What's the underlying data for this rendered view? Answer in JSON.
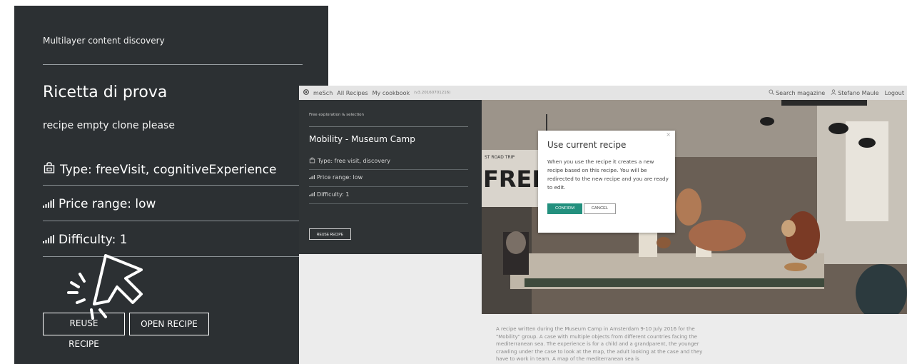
{
  "left_panel": {
    "section_label": "Multilayer content discovery",
    "title": "Ricetta di prova",
    "subtitle": "recipe empty clone please",
    "type_label": "Type: freeVisit, cognitiveExperience",
    "price_label": "Price range: low",
    "difficulty_label": "Difficulty: 1",
    "reuse_button": "REUSE RECIPE",
    "open_button": "OPEN RECIPE"
  },
  "app": {
    "topbar": {
      "brand": "meSch",
      "nav_all_recipes": "All Recipes",
      "nav_my_cookbook": "My cookbook",
      "version": "(v3.20160701216)",
      "search": "Search magazine",
      "user": "Stefano Maule",
      "logout": "Logout"
    },
    "sidebar": {
      "section_label": "Free exploration & selection",
      "title": "Mobility - Museum Camp",
      "type_label": "Type: free visit, discovery",
      "price_label": "Price range: low",
      "difficulty_label": "Difficulty: 1",
      "reuse_button": "REUSE RECIPE"
    },
    "photo_text": {
      "poster_word": "FREE",
      "poster_small": "ST ROAD TRIP"
    },
    "modal": {
      "title": "Use current recipe",
      "body": "When you use the recipe it creates a new recipe based on this recipe. You will be redirected to the new recipe and you are ready to edit.",
      "confirm": "CONFIRM",
      "cancel": "CANCEL",
      "close": "×"
    },
    "description": "A recipe written during the Museum Camp in Amsterdam 9-10 July 2016 for the \"Mobility\" group. A case with multiple objects from different countries facing the mediterranean sea. The experience is for a child and a grandparent, the younger crawling under the case to look at the map, the adult looking at the case and they have to work in team. A map of the mediterranean sea is"
  }
}
